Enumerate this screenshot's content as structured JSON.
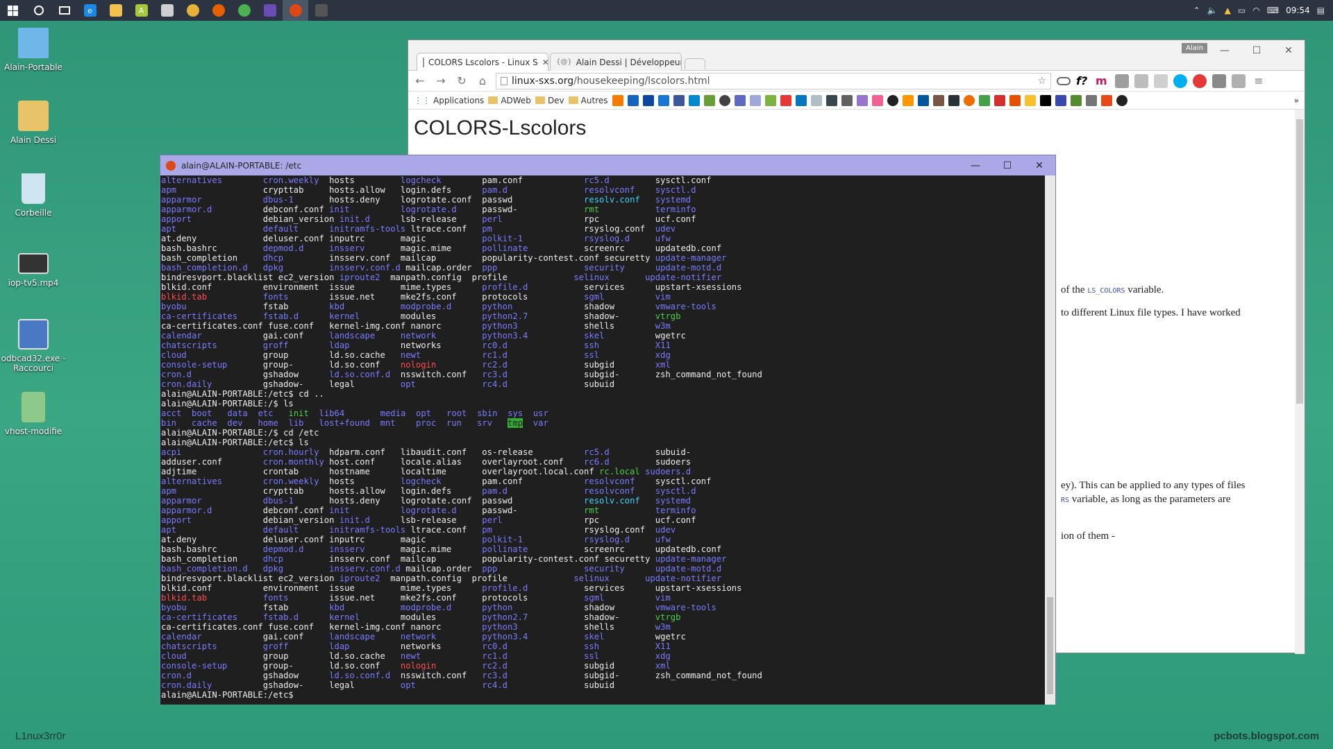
{
  "taskbar": {
    "clock": "09:54",
    "apps": [
      {
        "name": "start-icon",
        "color": "#ffffff"
      },
      {
        "name": "cortana-icon",
        "color": "#ffffff"
      },
      {
        "name": "task-view-icon",
        "color": "#ffffff"
      },
      {
        "name": "edge-icon",
        "color": "#1e88e5"
      },
      {
        "name": "file-explorer-icon",
        "color": "#f2c14e"
      },
      {
        "name": "app-green-icon",
        "color": "#a6c83a"
      },
      {
        "name": "app-window-icon",
        "color": "#cfcfcf"
      },
      {
        "name": "chrome-icon",
        "color": "#e8b13a"
      },
      {
        "name": "firefox-icon",
        "color": "#e66000"
      },
      {
        "name": "chrome-alt-icon",
        "color": "#4caf50"
      },
      {
        "name": "terminal-icon",
        "color": "#6a4cb2"
      },
      {
        "name": "ubuntu-icon",
        "color": "#dd4814"
      },
      {
        "name": "app-dark-icon",
        "color": "#555555"
      }
    ]
  },
  "desktop": {
    "icons": [
      {
        "label": "Alain-Portable",
        "color": "#6fb7e9"
      },
      {
        "label": "Alain Dessi",
        "color": "#e8c36a"
      },
      {
        "label": "Corbeille",
        "color": "#cfe6f2"
      },
      {
        "label": "iop-tv5.mp4",
        "color": "#333333"
      },
      {
        "label": "odbcad32.exe -\nRaccourci",
        "color": "#4a78c2"
      },
      {
        "label": "vhost-modifie",
        "color": "#8fc98a"
      }
    ],
    "watermark_left": "L1nux3rr0r",
    "watermark_right": "pcbots.blogspot.com"
  },
  "browser": {
    "user_badge": "Alain",
    "tabs": [
      {
        "label": "COLORS Lscolors - Linux S"
      },
      {
        "label": "Alain Dessi | Développeur w"
      }
    ],
    "url_domain": "linux-sxs.org",
    "url_path": "/housekeeping/lscolors.html",
    "bookmarks": [
      "Applications",
      "ADWeb",
      "Dev",
      "Autres"
    ],
    "page": {
      "title": "COLORS-Lscolors",
      "line1_a": "of the",
      "line1_code": "LS_COLORS",
      "line1_b": "variable.",
      "line2": "to different Linux file types. I have worked",
      "line3": "ey). This can be applied to any types of files",
      "line4_code": "RS",
      "line4_b": "variable, as long as the parameters are",
      "line5": "ion of them -"
    }
  },
  "terminal": {
    "title": "alain@ALAIN-PORTABLE: /etc",
    "prompt_final": "alain@ALAIN-PORTABLE:/etc$"
  },
  "colors": {
    "desktop": "#3aa683",
    "taskbar": "#2b3440",
    "terminal_title": "#aba8e8",
    "dir": "#7b7bff",
    "broken": "#ff4d4d",
    "exec": "#4cd04c",
    "link": "#3fd3ff"
  }
}
